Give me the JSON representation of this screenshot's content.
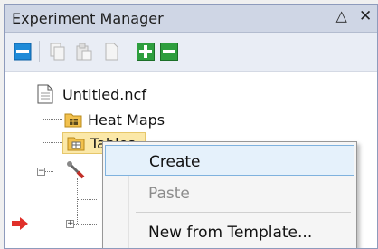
{
  "window": {
    "title": "Experiment Manager",
    "pin_icon": "pin-icon",
    "close_icon": "close-icon",
    "pin_glyph": "◁",
    "close_glyph": "✕"
  },
  "toolbar": {
    "buttons": [
      {
        "icon": "panel-icon",
        "enabled": true
      },
      {
        "icon": "copy-icon",
        "enabled": false
      },
      {
        "icon": "paste-icon",
        "enabled": false
      },
      {
        "icon": "document-icon",
        "enabled": false
      },
      {
        "icon": "add-icon",
        "enabled": true,
        "color": "#2e9e3e"
      },
      {
        "icon": "remove-icon",
        "enabled": true,
        "color": "#2e9e3e"
      }
    ]
  },
  "tree": {
    "root": {
      "label": "Untitled.ncf",
      "icon": "file-icon"
    },
    "items": [
      {
        "label": "Heat Maps",
        "icon": "heatmap-folder-icon"
      },
      {
        "label": "Tables",
        "icon": "table-folder-icon",
        "selected": true
      },
      {
        "label": "",
        "icon": "tools-icon",
        "expander": "−"
      },
      {
        "label": "",
        "icon": "",
        "expander": "+"
      }
    ],
    "arrow_icon": "arrow-right-icon",
    "arrow_color": "#e0302a"
  },
  "context_menu": {
    "items": [
      {
        "label": "Create",
        "state": "hover"
      },
      {
        "label": "Paste",
        "state": "disabled"
      },
      {
        "label": "New from Template...",
        "state": "normal"
      }
    ]
  },
  "colors": {
    "title_bar": "#cfd6e5",
    "accent_blue": "#1f8bd8",
    "green": "#2e9e3e",
    "selection": "#fbe8a8"
  }
}
